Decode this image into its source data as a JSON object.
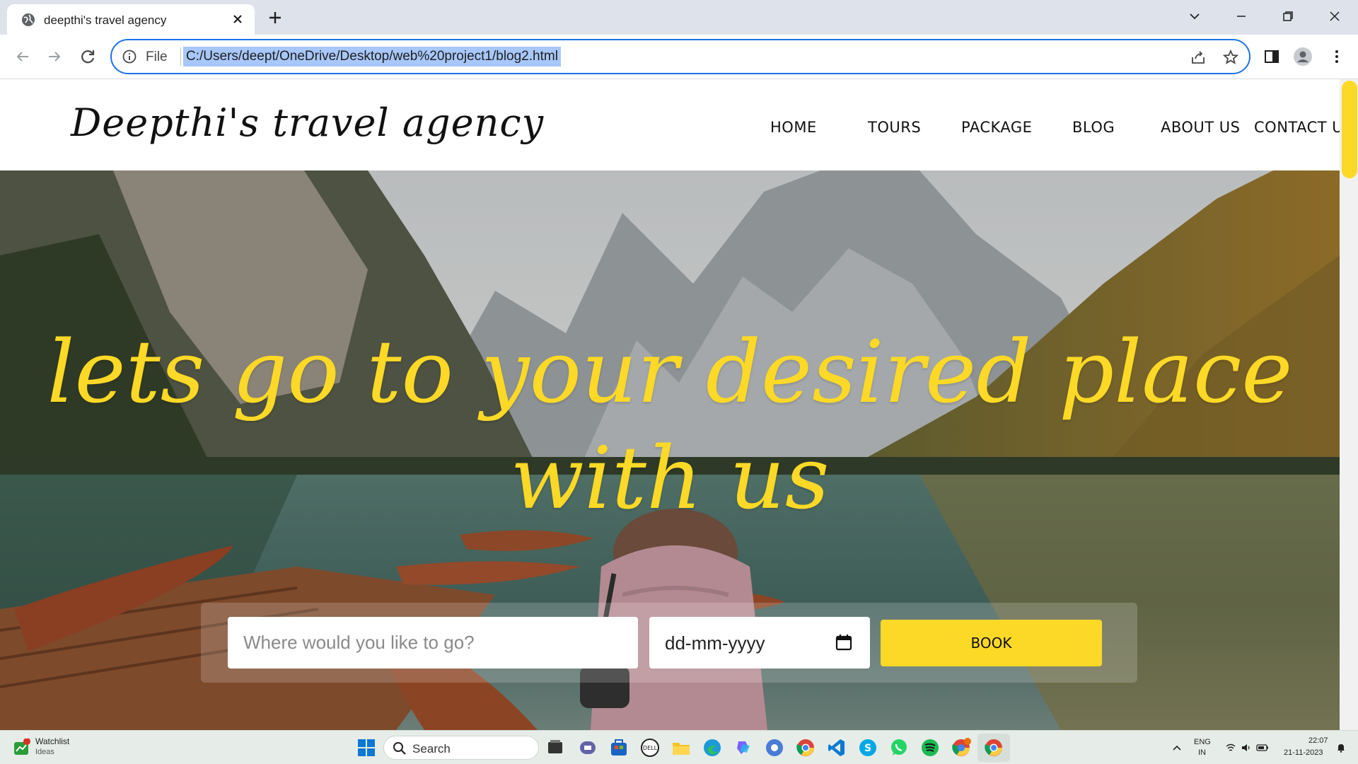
{
  "browser": {
    "tab_title": "deepthi's travel agency",
    "omnibox_scheme": "File",
    "url": "C:/Users/deept/OneDrive/Desktop/web%20project1/blog2.html",
    "accent": "#1a73e8"
  },
  "site": {
    "logo": "Deepthi's travel agency",
    "nav": [
      {
        "label": "HOME"
      },
      {
        "label": "TOURS"
      },
      {
        "label": "PACKAGE"
      },
      {
        "label": "BLOG"
      },
      {
        "label": "ABOUT US"
      },
      {
        "label": "CONTACT US"
      }
    ],
    "headline": "lets go to your desired place with us",
    "booking": {
      "destination_placeholder": "Where would you like to go?",
      "date_placeholder": "dd-mm-yyyy",
      "book_label": "BOOK"
    },
    "accent": "#fcd926"
  },
  "taskbar": {
    "widget_title": "Watchlist",
    "widget_subtitle": "Ideas",
    "widget_badge": "1",
    "search_label": "Search",
    "language": "ENG",
    "region": "IN",
    "time": "22:07",
    "date": "21-11-2023"
  }
}
